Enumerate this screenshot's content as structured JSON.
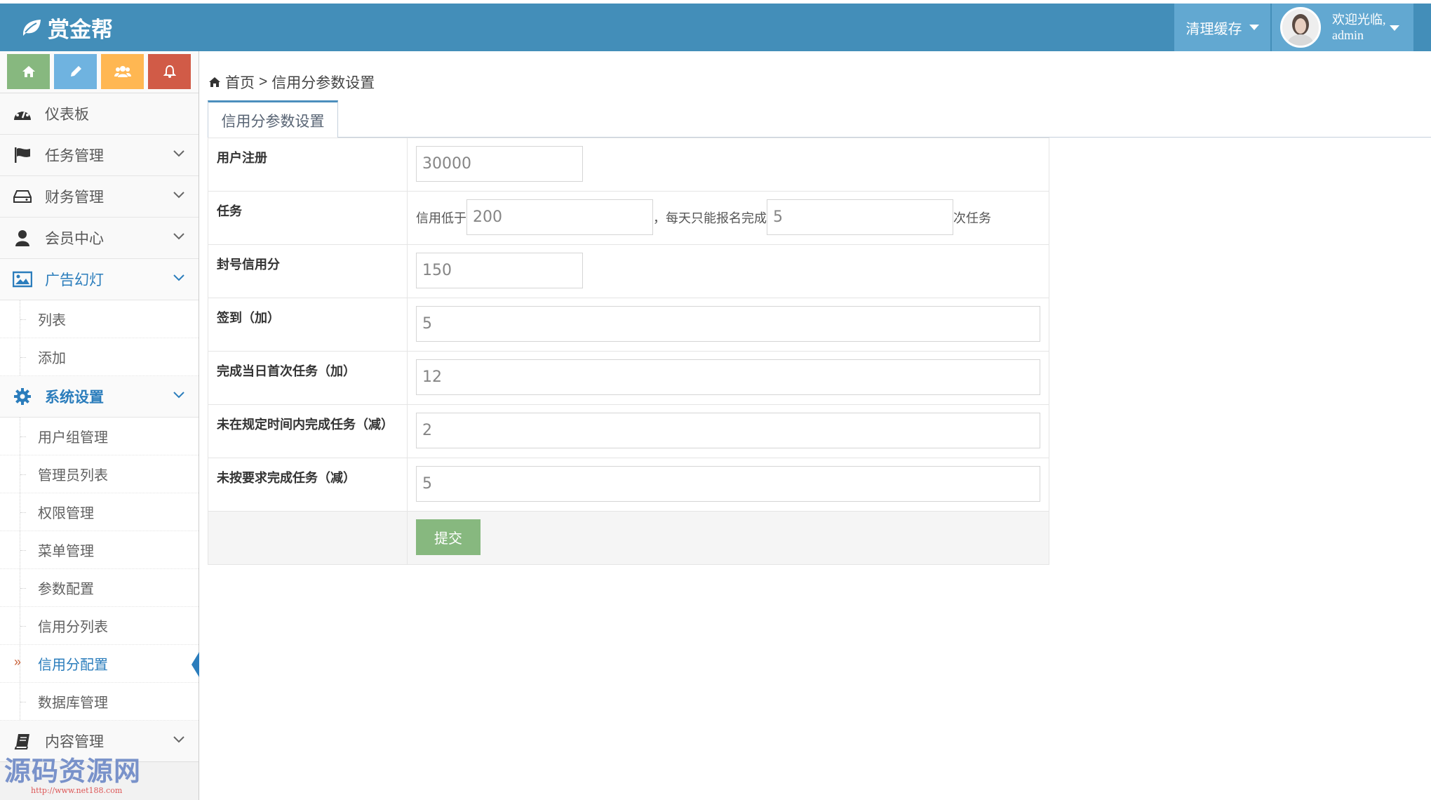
{
  "app": {
    "brand": "赏金帮"
  },
  "header": {
    "clear_cache": "清理缓存",
    "welcome": "欢迎光临,",
    "username": "admin"
  },
  "shortcuts": [
    {
      "name": "home-icon",
      "color": "#87b87f"
    },
    {
      "name": "pencil-icon",
      "color": "#6fb3e0"
    },
    {
      "name": "users-icon",
      "color": "#ffb752"
    },
    {
      "name": "bell-icon",
      "color": "#d15b47"
    }
  ],
  "sidebar": {
    "dashboard": "仪表板",
    "task_mgmt": "任务管理",
    "finance_mgmt": "财务管理",
    "member_center": "会员中心",
    "ad_slides": "广告幻灯",
    "ad_sub": [
      "列表",
      "添加"
    ],
    "system_settings": "系统设置",
    "system_sub": [
      "用户组管理",
      "管理员列表",
      "权限管理",
      "菜单管理",
      "参数配置",
      "信用分列表",
      "信用分配置",
      "数据库管理"
    ],
    "content_mgmt": "内容管理",
    "active_arrow": "»"
  },
  "breadcrumb": {
    "home": "首页",
    "sep": ">",
    "current": "信用分参数设置"
  },
  "tab": {
    "label": "信用分参数设置"
  },
  "form": {
    "register_label": "用户注册",
    "register_value": "30000",
    "task_label": "任务",
    "task_prefix": "信用低于",
    "task_credit_value": "200",
    "task_middle": "，每天只能报名完成",
    "task_count_value": "5",
    "task_suffix": "次任务",
    "ban_label": "封号信用分",
    "ban_value": "150",
    "signin_label": "签到（加）",
    "signin_value": "5",
    "first_task_label": "完成当日首次任务（加）",
    "first_task_value": "12",
    "overtime_label": "未在规定时间内完成任务（减）",
    "overtime_value": "2",
    "unqualified_label": "未按要求完成任务（减）",
    "unqualified_value": "5",
    "submit": "提交"
  },
  "watermark": {
    "text": "源码资源网",
    "url": "http://www.net188.com"
  }
}
